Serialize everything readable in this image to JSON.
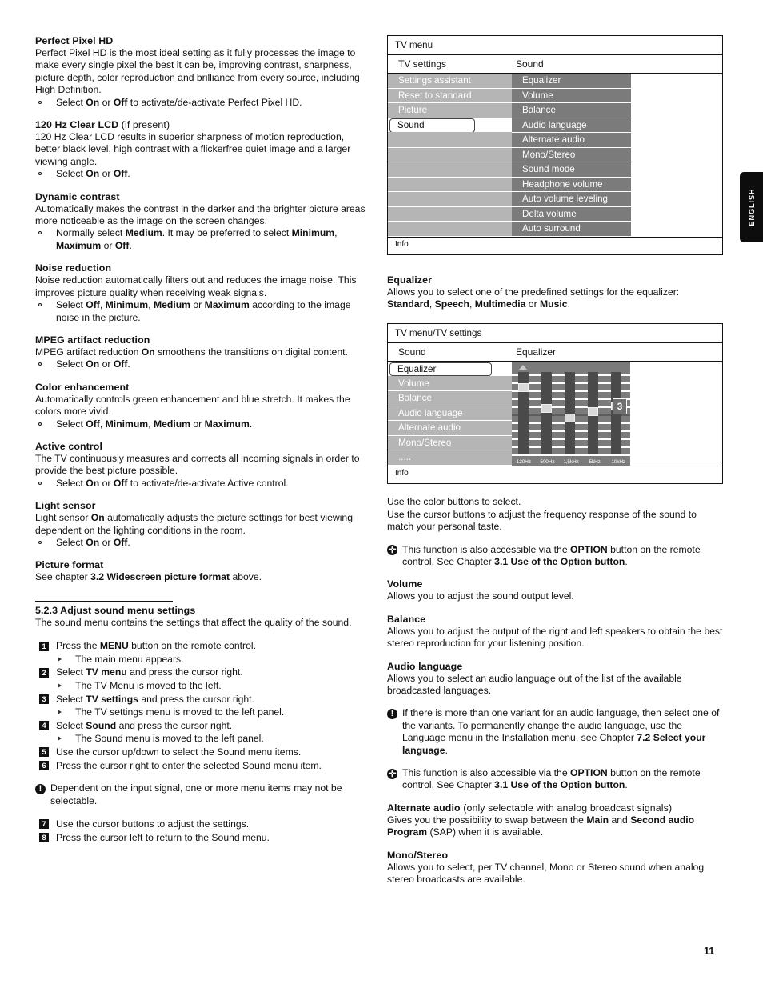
{
  "page": {
    "number": "11",
    "side_tab": "ENGLISH"
  },
  "left_column": {
    "sections": [
      {
        "heading": "Perfect Pixel HD",
        "heading_suffix": "",
        "paragraphs": [
          "Perfect Pixel HD is the most ideal setting as it fully processes the image to make every single pixel the best it can be, improving contrast, sharpness, picture depth, color reproduction and brilliance from every source, including High Definition."
        ],
        "bullets": [
          {
            "pre": "Select ",
            "b1": "On",
            "mid": " or ",
            "b2": "Off",
            "post": " to activate/de-activate Perfect Pixel HD."
          }
        ]
      },
      {
        "heading": "120 Hz Clear LCD",
        "heading_suffix": "(if present)",
        "paragraphs": [
          "120 Hz Clear LCD results in superior sharpness of motion reproduction, better black level, high contrast with a flickerfree quiet image and a larger viewing angle."
        ],
        "bullets": [
          {
            "pre": "Select ",
            "b1": "On",
            "mid": " or ",
            "b2": "Off",
            "post": "."
          }
        ]
      },
      {
        "heading": "Dynamic contrast",
        "heading_suffix": "",
        "paragraphs": [
          "Automatically makes the contrast in the darker and the brighter picture areas more noticeable as the image on the screen changes."
        ],
        "bullets": [
          {
            "pre": "Normally select ",
            "b1": "Medium",
            "mid": ". It may be preferred to select ",
            "b2": "Minimum",
            "post": ", ",
            "b3": "Maximum",
            "mid2": " or ",
            "b4": "Off",
            "post2": "."
          }
        ]
      },
      {
        "heading": "Noise reduction",
        "heading_suffix": "",
        "paragraphs": [
          "Noise reduction automatically filters out and reduces the image noise. This improves picture quality when receiving weak signals."
        ],
        "bullets": [
          {
            "pre": "Select ",
            "b1": "Off",
            "mid": ", ",
            "b2": "Minimum",
            "post": ", ",
            "b3": "Medium",
            "mid2": " or ",
            "b4": "Maximum",
            "post2": " according to the image noise in the picture."
          }
        ]
      },
      {
        "heading": "MPEG artifact reduction",
        "heading_suffix": "",
        "paragraphs": [
          "MPEG artifact reduction On smoothens the transitions on digital content."
        ],
        "bullets": [
          {
            "pre": "Select ",
            "b1": "On",
            "mid": " or ",
            "b2": "Off",
            "post": "."
          }
        ]
      },
      {
        "heading": "Color enhancement",
        "heading_suffix": "",
        "paragraphs": [
          "Automatically controls green enhancement and blue stretch. It makes the colors more vivid."
        ],
        "bullets": [
          {
            "pre": "Select ",
            "b1": "Off",
            "mid": ", ",
            "b2": "Minimum",
            "post": ", ",
            "b3": "Medium",
            "mid2": " or ",
            "b4": "Maximum",
            "post2": "."
          }
        ]
      },
      {
        "heading": "Active control",
        "heading_suffix": "",
        "paragraphs": [
          "The TV continuously measures and corrects all incoming signals in order to provide the best picture possible."
        ],
        "bullets": [
          {
            "pre": "Select ",
            "b1": "On",
            "mid": " or ",
            "b2": "Off",
            "post": " to activate/de-activate Active control."
          }
        ]
      },
      {
        "heading": "Light sensor",
        "heading_suffix": "",
        "paragraphs": [
          "Light sensor On automatically adjusts the picture settings for best viewing dependent on the lighting conditions in the room."
        ],
        "bullets": [
          {
            "pre": "Select ",
            "b1": "On",
            "mid": " or ",
            "b2": "Off",
            "post": "."
          }
        ]
      },
      {
        "heading": "Picture format",
        "heading_suffix": "",
        "paragraphs": [
          "See chapter 3.2 Widescreen picture format above."
        ],
        "bullets": []
      }
    ],
    "subsection": {
      "heading": "5.2.3 Adjust sound menu settings",
      "intro": "The sound menu contains the settings that affect the quality of the sound.",
      "steps": [
        {
          "num": "1",
          "pre": "Press the ",
          "bold": "MENU",
          "post": " button on the remote control.",
          "sub": "The main menu appears."
        },
        {
          "num": "2",
          "pre": "Select ",
          "bold": "TV menu",
          "post": " and press the cursor right.",
          "sub": "The TV Menu is moved to the left."
        },
        {
          "num": "3",
          "pre": "Select ",
          "bold": "TV settings",
          "post": " and press the cursor right.",
          "sub": "The TV settings menu is moved to the left panel."
        },
        {
          "num": "4",
          "pre": "Select ",
          "bold": "Sound",
          "post": " and press the cursor right.",
          "sub": "The Sound menu is moved to the left panel."
        },
        {
          "num": "5",
          "pre": "Use the cursor up/down to select the Sound menu items.",
          "bold": "",
          "post": "",
          "sub": ""
        },
        {
          "num": "6",
          "pre": "Press the cursor right to enter the selected Sound menu item.",
          "bold": "",
          "post": "",
          "sub": ""
        }
      ],
      "note": "Dependent on the input signal, one or more menu items may not be selectable.",
      "steps2": [
        {
          "num": "7",
          "pre": "Use the cursor buttons to adjust the settings."
        },
        {
          "num": "8",
          "pre": "Press the cursor left to return to the Sound menu."
        }
      ]
    }
  },
  "tv_menu_mock": {
    "title": "TV menu",
    "head_left": "TV settings",
    "head_right": "Sound",
    "left_items": [
      "Settings assistant",
      "Reset to standard",
      "Picture",
      "Sound"
    ],
    "left_selected": "Sound",
    "right_items": [
      "Equalizer",
      "Volume",
      "Balance",
      "Audio language",
      "Alternate audio",
      "Mono/Stereo",
      "Sound mode",
      "Headphone volume",
      "Auto volume leveling",
      "Delta volume",
      "Auto surround"
    ],
    "info": "Info"
  },
  "eq_menu_mock": {
    "title": "TV menu/TV settings",
    "head_left": "Sound",
    "head_right": "Equalizer",
    "left_items": [
      "Equalizer",
      "Volume",
      "Balance",
      "Audio language",
      "Alternate audio",
      "Mono/Stereo",
      "....."
    ],
    "left_selected": "Equalizer",
    "info": "Info",
    "value_box": "3",
    "frequencies": [
      "120Hz",
      "500Hz",
      "1,5kHz",
      "5kHz",
      "10kHz"
    ],
    "slider_levels": [
      0.85,
      0.47,
      0.35,
      0.45,
      0.52
    ]
  },
  "right_column": {
    "sections": [
      {
        "heading": "Equalizer",
        "paragraphs": [
          "Allows you to select one of the predefined settings for the equalizer: Standard, Speech, Multimedia or Music."
        ]
      },
      {
        "heading": "",
        "paragraphs": [
          "Use the color buttons to select.",
          "Use the cursor buttons to adjust the frequency response of the sound to match your personal taste."
        ]
      },
      {
        "heading": "Volume",
        "paragraphs": [
          "Allows you to adjust the sound output level."
        ]
      },
      {
        "heading": "Balance",
        "paragraphs": [
          "Allows you to adjust the output of the right and left speakers to obtain the best stereo reproduction for your listening position."
        ]
      },
      {
        "heading": "Audio language",
        "paragraphs": [
          "Allows you to select an audio language out of the list of the available broadcasted languages."
        ]
      },
      {
        "heading": "Mono/Stereo",
        "paragraphs": [
          "Allows you to select, per TV channel, Mono or Stereo sound when analog stereo broadcasts are available."
        ]
      }
    ],
    "notes": {
      "option_note_1": "This function is also accessible via the OPTION button on the remote control. See Chapter 3.1 Use of the Option button.",
      "language_note": "If there is more than one variant for an audio language, then select one of the variants. To permanently change the audio language, use the Language menu in the Installation menu, see Chapter 7.2 Select your language.",
      "option_note_2": "This function is also accessible via the OPTION button on the remote control. See Chapter 3.1 Use of the Option button."
    },
    "alternate_audio": {
      "heading_bold": "Alternate audio",
      "heading_normal": "(only selectable with analog broadcast signals)",
      "body": "Gives you the possibility to swap between the Main and Second audio Program (SAP) when it is available."
    }
  }
}
